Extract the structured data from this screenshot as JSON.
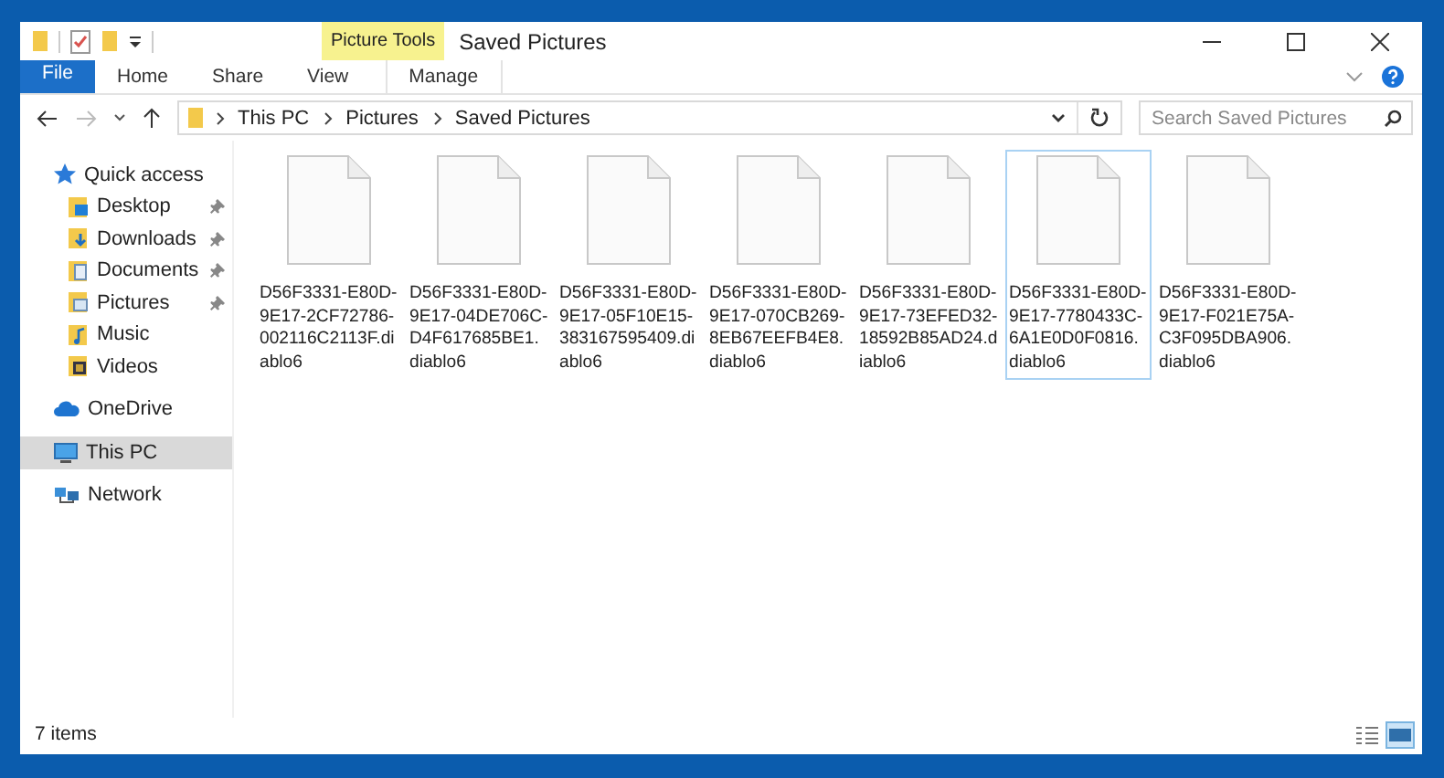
{
  "window": {
    "title": "Saved Pictures",
    "context_tab": "Picture Tools"
  },
  "ribbon_tabs": [
    {
      "label": "File",
      "kind": "file",
      "selected": false
    },
    {
      "label": "Home",
      "kind": "tab",
      "selected": false
    },
    {
      "label": "Share",
      "kind": "tab",
      "selected": false
    },
    {
      "label": "View",
      "kind": "tab",
      "selected": false
    },
    {
      "label": "Manage",
      "kind": "context",
      "selected": false
    }
  ],
  "address_bar": {
    "path": [
      "This PC",
      "Pictures",
      "Saved Pictures"
    ]
  },
  "search": {
    "placeholder": "Search Saved Pictures"
  },
  "sidebar": {
    "items": [
      {
        "label": "Quick access",
        "kind": "star",
        "selected": false,
        "children": [
          {
            "label": "Desktop",
            "kind": "desktop",
            "pinned": true,
            "selected": false
          },
          {
            "label": "Downloads",
            "kind": "downloads",
            "pinned": true,
            "selected": false
          },
          {
            "label": "Documents",
            "kind": "documents",
            "pinned": true,
            "selected": false
          },
          {
            "label": "Pictures",
            "kind": "pictures",
            "pinned": true,
            "selected": false
          },
          {
            "label": "Music",
            "kind": "music",
            "pinned": false,
            "selected": false
          },
          {
            "label": "Videos",
            "kind": "videos",
            "pinned": false,
            "selected": false
          }
        ]
      },
      {
        "label": "OneDrive",
        "kind": "cloud",
        "selected": false
      },
      {
        "label": "This PC",
        "kind": "pc",
        "selected": true
      },
      {
        "label": "Network",
        "kind": "network",
        "selected": false
      }
    ]
  },
  "files": [
    {
      "name": "D56F3331-E80D-9E17-2CF72786-002116C2113F.diablo6",
      "selected": false
    },
    {
      "name": "D56F3331-E80D-9E17-04DE706C-D4F617685BE1.diablo6",
      "selected": false
    },
    {
      "name": "D56F3331-E80D-9E17-05F10E15-383167595409.diablo6",
      "selected": false
    },
    {
      "name": "D56F3331-E80D-9E17-070CB269-8EB67EEFB4E8.diablo6",
      "selected": false
    },
    {
      "name": "D56F3331-E80D-9E17-73EFED32-18592B85AD24.diablo6",
      "selected": false
    },
    {
      "name": "D56F3331-E80D-9E17-7780433C-6A1E0D0F0816.diablo6",
      "selected": true
    },
    {
      "name": "D56F3331-E80D-9E17-F021E75A-C3F095DBA906.diablo6",
      "selected": false
    }
  ],
  "status_bar": {
    "item_count": "7 items",
    "views": [
      {
        "kind": "details",
        "selected": false
      },
      {
        "kind": "large-icons",
        "selected": true
      }
    ]
  }
}
